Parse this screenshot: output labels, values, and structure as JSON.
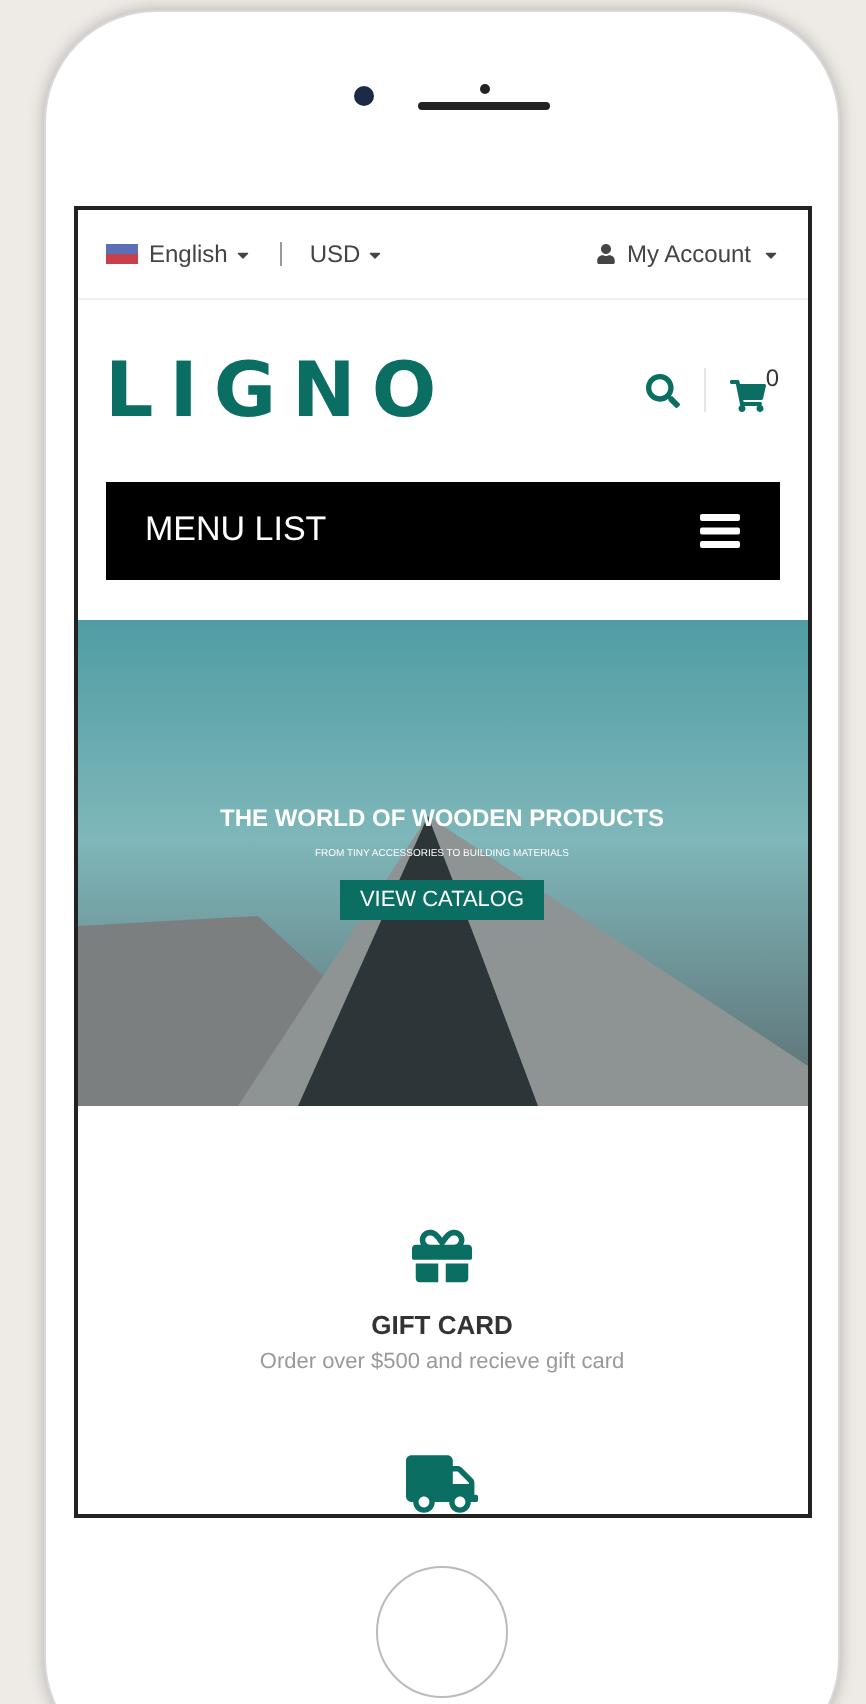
{
  "top_bar": {
    "language": "English",
    "currency": "USD",
    "account": "My Account"
  },
  "header": {
    "logo": "LIGNO",
    "cart_count": "0"
  },
  "menu": {
    "label": "MENU LIST"
  },
  "hero": {
    "title": "THE WORLD OF WOODEN PRODUCTS",
    "subtitle": "FROM TINY ACCESSORIES TO BUILDING MATERIALS",
    "button": "VIEW CATALOG"
  },
  "features": [
    {
      "kind": "gift",
      "title": "GIFT CARD",
      "text": "Order over $500 and recieve gift card"
    },
    {
      "kind": "truck"
    }
  ]
}
